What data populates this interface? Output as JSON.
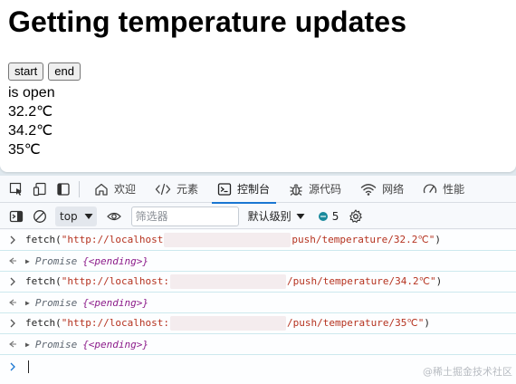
{
  "page": {
    "heading": "Getting temperature updates",
    "start_label": "start",
    "end_label": "end",
    "output_lines": [
      "is open",
      "32.2℃",
      "34.2℃",
      "35℃"
    ]
  },
  "devtools": {
    "tabs": [
      {
        "label": "欢迎",
        "icon": "home-icon"
      },
      {
        "label": "元素",
        "icon": "code-icon"
      },
      {
        "label": "控制台",
        "icon": "console-icon",
        "active": true
      },
      {
        "label": "源代码",
        "icon": "bug-icon"
      },
      {
        "label": "网络",
        "icon": "wifi-icon"
      },
      {
        "label": "性能",
        "icon": "gauge-icon"
      }
    ],
    "toolbar": {
      "context": "top",
      "filter_placeholder": "筛选器",
      "levels": "默认级别",
      "message_count": "5"
    },
    "console": [
      {
        "kind": "input",
        "prefix": "fetch(\"http://localhost",
        "suffix": "push/temperature/32.2℃\")"
      },
      {
        "kind": "output",
        "label": "Promise",
        "state": "{<pending>}"
      },
      {
        "kind": "input",
        "prefix": "fetch(\"http://localhost:",
        "suffix": "/push/temperature/34.2℃\")"
      },
      {
        "kind": "output",
        "label": "Promise",
        "state": "{<pending>}"
      },
      {
        "kind": "input",
        "prefix": "fetch(\"http://localhost:",
        "suffix": "/push/temperature/35℃\")"
      },
      {
        "kind": "output",
        "label": "Promise",
        "state": "{<pending>}"
      }
    ]
  },
  "watermark": "@稀土掘金技术社区",
  "colors": {
    "accent": "#1976d2",
    "string": "#b5321f",
    "pending": "#8c1c8a",
    "row_border": "#cde9ee"
  }
}
